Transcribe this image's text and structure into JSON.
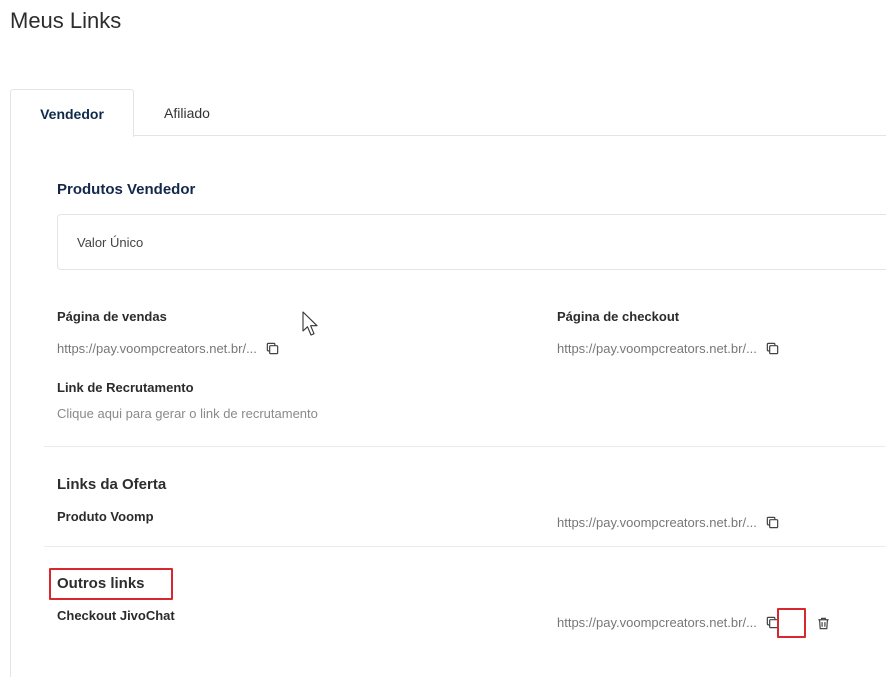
{
  "page": {
    "title": "Meus Links"
  },
  "tabs": [
    {
      "label": "Vendedor",
      "active": true
    },
    {
      "label": "Afiliado",
      "active": false
    }
  ],
  "produtos_vendedor": {
    "title": "Produtos Vendedor",
    "product_option": "Valor Único",
    "pagina_vendas": {
      "label": "Página de vendas",
      "url": "https://pay.voompcreators.net.br/..."
    },
    "pagina_checkout": {
      "label": "Página de checkout",
      "url": "https://pay.voompcreators.net.br/..."
    },
    "link_recrutamento": {
      "label": "Link de Recrutamento",
      "action_text": "Clique aqui para gerar o link de recrutamento"
    }
  },
  "links_oferta": {
    "title": "Links da Oferta",
    "items": [
      {
        "label": "Produto Voomp",
        "url": "https://pay.voompcreators.net.br/..."
      }
    ]
  },
  "outros_links": {
    "title": "Outros links",
    "items": [
      {
        "label": "Checkout JivoChat",
        "url": "https://pay.voompcreators.net.br/..."
      }
    ]
  },
  "colors": {
    "highlight": "#d9272e",
    "primary_text": "#14294a"
  },
  "icons": {
    "copy": "copy-icon",
    "delete": "trash-icon"
  }
}
